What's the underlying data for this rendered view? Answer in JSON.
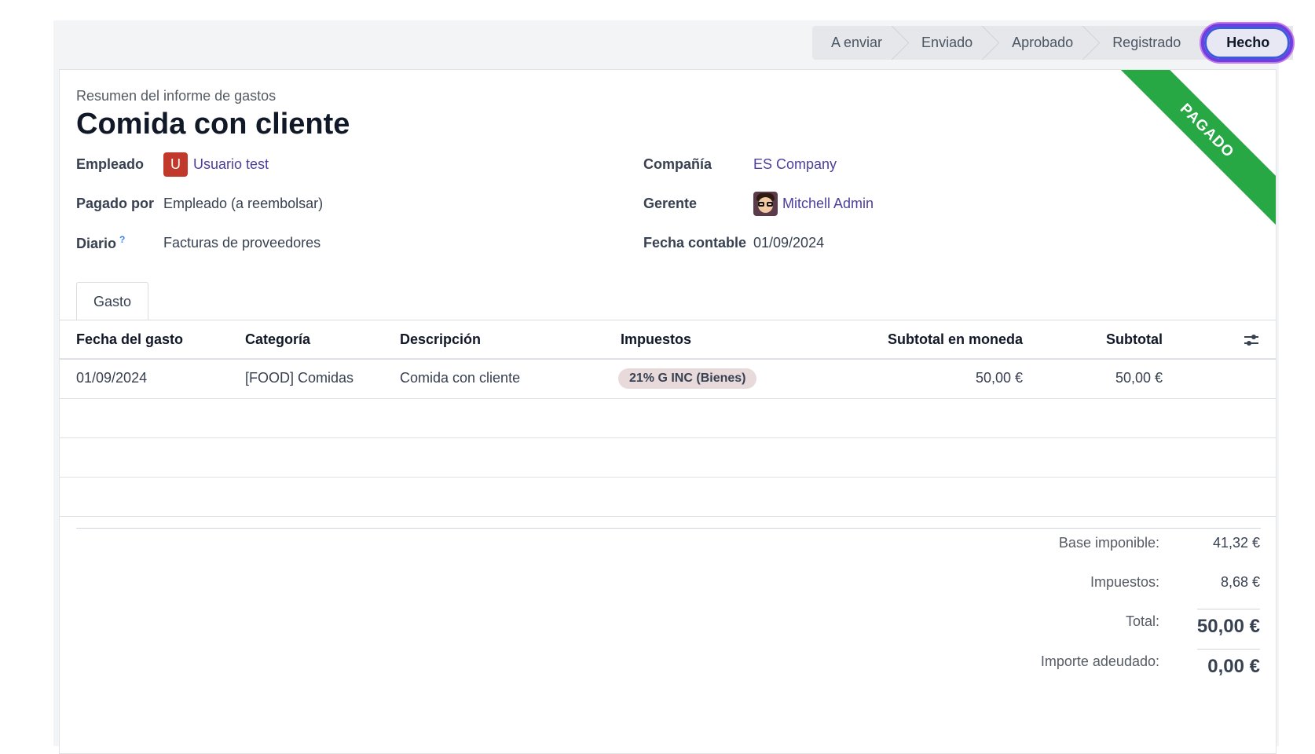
{
  "statusbar": {
    "stages": [
      "A enviar",
      "Enviado",
      "Aprobado",
      "Registrado"
    ],
    "active": "Hecho"
  },
  "ribbon": "PAGADO",
  "header": {
    "subtitle": "Resumen del informe de gastos",
    "title": "Comida con cliente"
  },
  "fields": {
    "employee_label": "Empleado",
    "employee_initial": "U",
    "employee_value": "Usuario test",
    "paid_by_label": "Pagado por",
    "paid_by_value": "Empleado (a reembolsar)",
    "journal_label": "Diario",
    "journal_help": "?",
    "journal_value": "Facturas de proveedores",
    "company_label": "Compañía",
    "company_value": "ES Company",
    "manager_label": "Gerente",
    "manager_value": "Mitchell Admin",
    "accounting_date_label": "Fecha contable",
    "accounting_date_value": "01/09/2024"
  },
  "tabs": [
    {
      "label": "Gasto"
    }
  ],
  "table": {
    "headers": [
      "Fecha del gasto",
      "Categoría",
      "Descripción",
      "Impuestos",
      "Subtotal en moneda",
      "Subtotal"
    ],
    "rows": [
      {
        "date": "01/09/2024",
        "category": "[FOOD] Comidas",
        "description": "Comida con cliente",
        "tax": "21% G INC (Bienes)",
        "subtotal_currency": "50,00 €",
        "subtotal": "50,00 €"
      }
    ]
  },
  "totals": {
    "base_label": "Base imponible:",
    "base_value": "41,32 €",
    "tax_label": "Impuestos:",
    "tax_value": "8,68 €",
    "total_label": "Total:",
    "total_value": "50,00 €",
    "due_label": "Importe adeudado:",
    "due_value": "0,00 €"
  },
  "colors": {
    "ribbon": "#28a745",
    "link": "#4b3f9e",
    "active_stage_border": "#6d3ee0"
  }
}
